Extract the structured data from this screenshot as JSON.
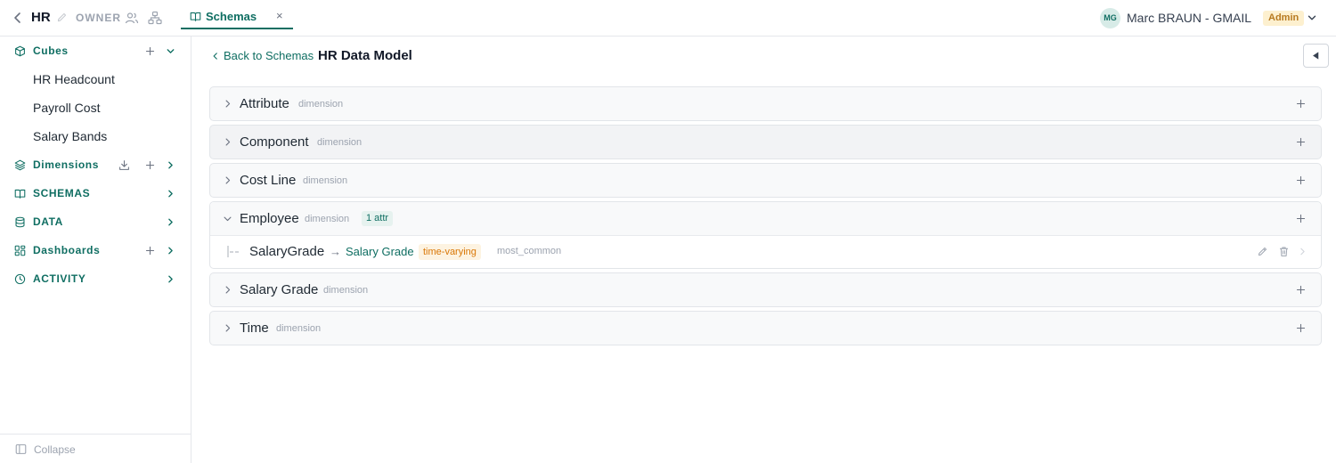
{
  "topbar": {
    "app_name": "HR",
    "role": "OWNER",
    "tab": {
      "label": "Schemas",
      "close": "×"
    },
    "user": {
      "initials": "MG",
      "name": "Marc BRAUN - GMAIL",
      "badge": "Admin"
    }
  },
  "sidebar": {
    "cubes": {
      "label": "Cubes",
      "items": [
        "HR Headcount",
        "Payroll Cost",
        "Salary Bands"
      ]
    },
    "dimensions": {
      "label": "Dimensions"
    },
    "schemas": {
      "label": "SCHEMAS"
    },
    "data": {
      "label": "DATA"
    },
    "dashboards": {
      "label": "Dashboards"
    },
    "activity": {
      "label": "ACTIVITY"
    },
    "collapse": "Collapse"
  },
  "main": {
    "back_label": "Back to Schemas",
    "title": "HR Data Model",
    "dimensions": [
      {
        "name": "Attribute",
        "type": "dimension"
      },
      {
        "name": "Component",
        "type": "dimension"
      },
      {
        "name": "Cost Line",
        "type": "dimension"
      },
      {
        "name": "Employee",
        "type": "dimension",
        "badge": "1 attr",
        "expanded": true,
        "attributes": [
          {
            "name": "SalaryGrade",
            "arrow": "→",
            "target": "Salary Grade",
            "tag": "time-varying",
            "aggregation": "most_common"
          }
        ]
      },
      {
        "name": "Salary Grade",
        "type": "dimension"
      },
      {
        "name": "Time",
        "type": "dimension"
      }
    ]
  },
  "colors": {
    "accent": "#0f6e62",
    "admin_badge_bg": "#fdf0cf",
    "time_varying_text": "#d97706"
  }
}
